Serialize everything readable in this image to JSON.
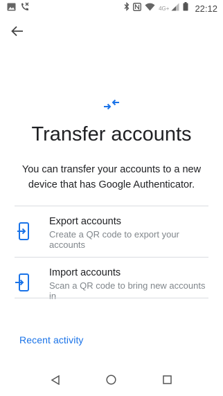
{
  "status_bar": {
    "left_icons": [
      "image-icon",
      "missed-call-icon"
    ],
    "right_icons": [
      "bluetooth-icon",
      "nfc-icon",
      "wifi-icon",
      "signal-icon",
      "battery-icon"
    ],
    "network_label": "4G+",
    "time": "22:12"
  },
  "header": {
    "back_icon": "arrow-back-icon"
  },
  "hero": {
    "icon": "transfer-arrows-icon",
    "title": "Transfer accounts",
    "subtitle": "You can transfer your accounts to a new device that has Google Authenticator."
  },
  "options": [
    {
      "icon": "export-phone-icon",
      "title": "Export accounts",
      "description": "Create a QR code to export your accounts"
    },
    {
      "icon": "import-phone-icon",
      "title": "Import accounts",
      "description": "Scan a QR code to bring new accounts in"
    }
  ],
  "recent_activity_label": "Recent activity",
  "nav_bar": [
    "back-triangle-icon",
    "home-circle-icon",
    "recents-square-icon"
  ],
  "colors": {
    "accent": "#1a73e8",
    "divider": "#dadce0",
    "secondary_text": "#80868b"
  }
}
